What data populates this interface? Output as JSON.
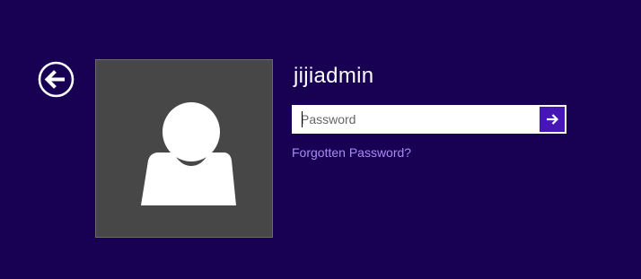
{
  "login": {
    "username": "jijiadmin",
    "password_placeholder": "Password",
    "password_value": "",
    "forgot_password_label": "Forgotten Password?"
  },
  "icons": {
    "back": "back-arrow-circle-icon",
    "submit": "right-arrow-icon",
    "avatar": "user-silhouette-icon"
  },
  "colors": {
    "background": "#180052",
    "avatar_tile": "#474747",
    "submit_button": "#4617b4",
    "link": "#a98af5",
    "text": "#ffffff"
  }
}
